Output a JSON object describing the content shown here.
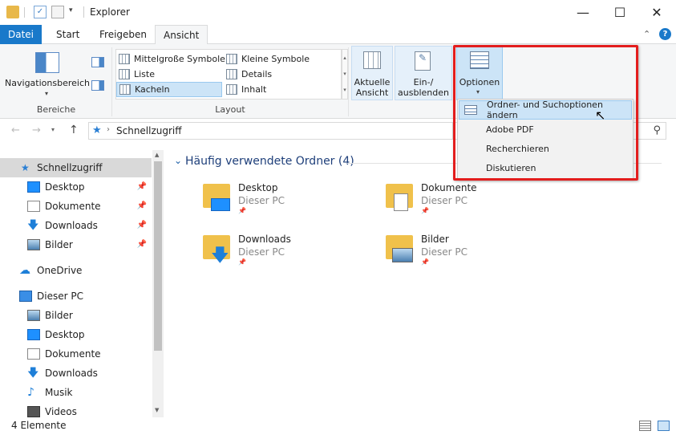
{
  "window": {
    "title": "Explorer"
  },
  "tabs": [
    {
      "label": "Datei"
    },
    {
      "label": "Start"
    },
    {
      "label": "Freigeben"
    },
    {
      "label": "Ansicht"
    }
  ],
  "ribbon": {
    "bereiche": {
      "nav_label": "Navigationsbereich",
      "group_label": "Bereiche"
    },
    "layout": {
      "group_label": "Layout",
      "items": [
        {
          "label": "Mittelgroße Symbole"
        },
        {
          "label": "Kleine Symbole"
        },
        {
          "label": "Liste"
        },
        {
          "label": "Details"
        },
        {
          "label": "Kacheln"
        },
        {
          "label": "Inhalt"
        }
      ]
    },
    "aktuelle_ansicht": {
      "line1": "Aktuelle",
      "line2": "Ansicht"
    },
    "einausblenden": {
      "line1": "Ein-/",
      "line2": "ausblenden"
    },
    "optionen": {
      "label": "Optionen"
    }
  },
  "menu": {
    "items": [
      {
        "label": "Ordner- und Suchoptionen ändern"
      },
      {
        "label": "Adobe PDF"
      },
      {
        "label": "Recherchieren"
      },
      {
        "label": "Diskutieren"
      }
    ]
  },
  "address": {
    "path": "Schnellzugriff"
  },
  "sidebar": {
    "items": [
      {
        "label": "Schnellzugriff"
      },
      {
        "label": "Desktop"
      },
      {
        "label": "Dokumente"
      },
      {
        "label": "Downloads"
      },
      {
        "label": "Bilder"
      },
      {
        "label": "OneDrive"
      },
      {
        "label": "Dieser PC"
      },
      {
        "label": "Bilder"
      },
      {
        "label": "Desktop"
      },
      {
        "label": "Dokumente"
      },
      {
        "label": "Downloads"
      },
      {
        "label": "Musik"
      },
      {
        "label": "Videos"
      }
    ]
  },
  "content": {
    "section_title": "Häufig verwendete Ordner (4)",
    "folders": [
      {
        "name": "Desktop",
        "location": "Dieser PC"
      },
      {
        "name": "Dokumente",
        "location": "Dieser PC"
      },
      {
        "name": "Downloads",
        "location": "Dieser PC"
      },
      {
        "name": "Bilder",
        "location": "Dieser PC"
      }
    ]
  },
  "status": {
    "count": "4 Elemente"
  },
  "colors": {
    "accent": "#1979ca",
    "highlight_frame": "#e31d1d",
    "folder": "#f0c14b"
  }
}
